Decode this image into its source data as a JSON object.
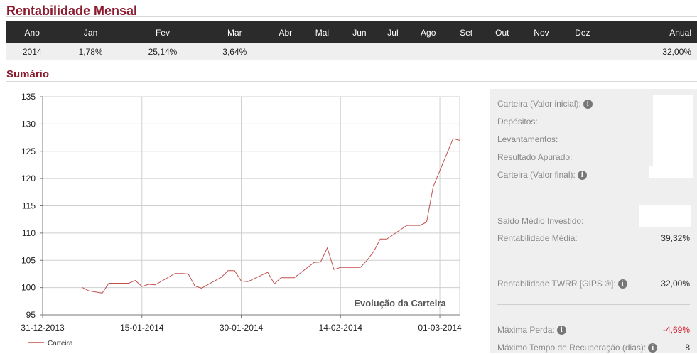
{
  "rentabilidade": {
    "title": "Rentabilidade Mensal",
    "columns": [
      "Ano",
      "Jan",
      "Fev",
      "Mar",
      "Abr",
      "Mai",
      "Jun",
      "Jul",
      "Ago",
      "Set",
      "Out",
      "Nov",
      "Dez",
      "Anual"
    ],
    "row": [
      "2014",
      "1,78%",
      "25,14%",
      "3,64%",
      "",
      "",
      "",
      "",
      "",
      "",
      "",
      "",
      "",
      "32,00%"
    ]
  },
  "sumario": {
    "title": "Sumário"
  },
  "chart_data": {
    "type": "line",
    "title": "Evolução da Carteira",
    "xlabel": "",
    "ylabel": "",
    "ylim": [
      95,
      135
    ],
    "yticks": [
      "95",
      "100",
      "105",
      "110",
      "115",
      "120",
      "125",
      "130",
      "135"
    ],
    "xticks": [
      "31-12-2013",
      "15-01-2014",
      "30-01-2014",
      "14-02-2014",
      "01-03-2014"
    ],
    "grid": true,
    "legend": "bottom-left",
    "series": [
      {
        "name": "Carteira",
        "color": "#c0504d",
        "x": [
          "2014-01-06",
          "2014-01-07",
          "2014-01-08",
          "2014-01-09",
          "2014-01-10",
          "2014-01-13",
          "2014-01-14",
          "2014-01-15",
          "2014-01-16",
          "2014-01-17",
          "2014-01-20",
          "2014-01-21",
          "2014-01-22",
          "2014-01-23",
          "2014-01-24",
          "2014-01-27",
          "2014-01-28",
          "2014-01-29",
          "2014-01-30",
          "2014-01-31",
          "2014-02-03",
          "2014-02-04",
          "2014-02-05",
          "2014-02-06",
          "2014-02-07",
          "2014-02-10",
          "2014-02-11",
          "2014-02-12",
          "2014-02-13",
          "2014-02-14",
          "2014-02-17",
          "2014-02-18",
          "2014-02-19",
          "2014-02-20",
          "2014-02-21",
          "2014-02-24",
          "2014-02-25",
          "2014-02-26",
          "2014-02-27",
          "2014-02-28",
          "2014-03-03",
          "2014-03-04"
        ],
        "values": [
          100.0,
          99.4,
          99.2,
          99.0,
          100.8,
          100.8,
          101.3,
          100.2,
          100.6,
          100.5,
          102.6,
          102.6,
          102.5,
          100.3,
          99.9,
          101.9,
          103.1,
          103.1,
          101.2,
          101.1,
          102.8,
          100.7,
          101.8,
          101.8,
          101.8,
          104.6,
          104.7,
          107.3,
          103.3,
          103.7,
          103.7,
          105.0,
          106.6,
          108.9,
          108.9,
          111.4,
          111.4,
          111.4,
          112.0,
          118.5,
          127.3,
          127.0
        ]
      }
    ]
  },
  "summary": {
    "rows1": [
      {
        "label": "Carteira (Valor inicial):",
        "info": true,
        "value": ""
      },
      {
        "label": "Depósitos:",
        "info": false,
        "value": ""
      },
      {
        "label": "Levantamentos:",
        "info": false,
        "value": ""
      },
      {
        "label": "Resultado Apurado:",
        "info": false,
        "value": ""
      },
      {
        "label": "Carteira (Valor final):",
        "info": true,
        "value": ""
      }
    ],
    "saldo_label": "Saldo Médio Investido:",
    "rent_media_label": "Rentabilidade Média:",
    "rent_media_value": "39,32%",
    "twrr_label": "Rentabilidade TWRR [GIPS ®]:",
    "twrr_value": "32,00%",
    "max_perda_label": "Máxima Perda:",
    "max_perda_value": "-4,69%",
    "max_rec_label": "Máximo Tempo de Recuperação (dias):",
    "max_rec_value": "8",
    "info_glyph": "i",
    "negative_color": "#d21f2a"
  }
}
